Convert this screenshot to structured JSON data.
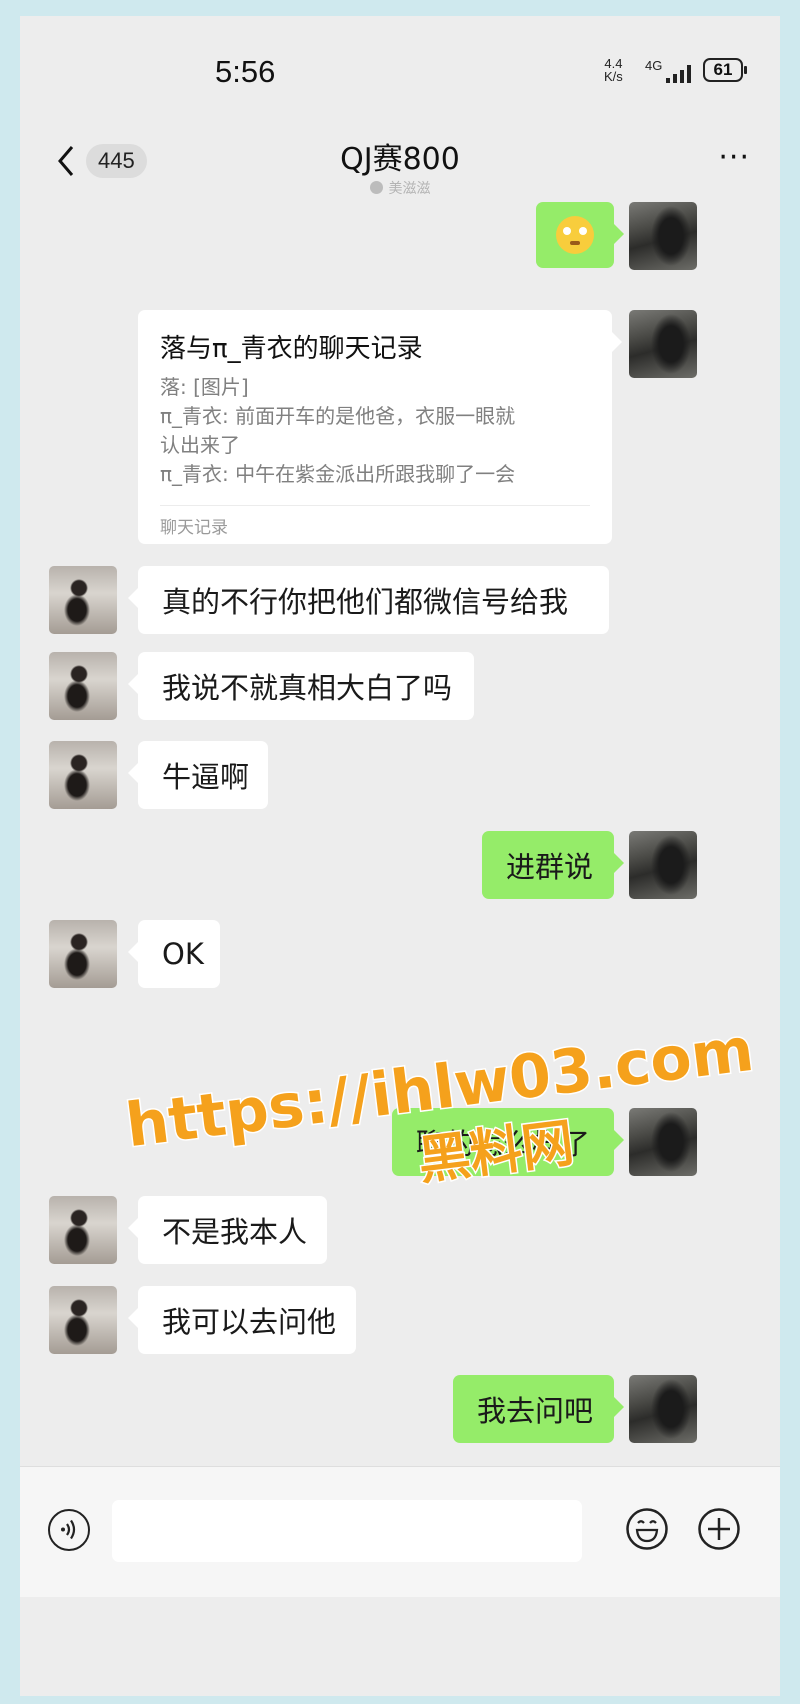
{
  "status_bar": {
    "time": "5:56",
    "net_speed_value": "4.4",
    "net_speed_unit": "K/s",
    "network_type": "4G",
    "battery": "61"
  },
  "header": {
    "back_count": "445",
    "title": "QJ赛800",
    "subtitle": "美滋滋",
    "more_label": "···"
  },
  "record_card": {
    "title": "落与π_青衣的聊天记录",
    "lines": [
      "落: [图片]",
      "π_青衣: 前面开车的是他爸，衣服一眼就",
      "认出来了",
      "π_青衣: 中午在紫金派出所跟我聊了一会"
    ],
    "footer": "聊天记录"
  },
  "messages": [
    {
      "side": "in",
      "text": "真的不行你把他们都微信号给我"
    },
    {
      "side": "in",
      "text": "我说不就真相大白了吗"
    },
    {
      "side": "in",
      "text": "牛逼啊"
    },
    {
      "side": "out",
      "text": "进群说"
    },
    {
      "side": "in",
      "text": "OK"
    },
    {
      "side": "out",
      "text": "聊的怎么样了"
    },
    {
      "side": "in",
      "text": "不是我本人"
    },
    {
      "side": "in",
      "text": "我可以去问他"
    },
    {
      "side": "out",
      "text": "我去问吧"
    }
  ],
  "watermark": {
    "line1": "https://ihlw03.com",
    "line2": "黑料网",
    "fill_color": "#f5a11c",
    "stroke_color": "#ffffff"
  },
  "input_bar": {
    "placeholder": ""
  },
  "icons": {
    "back": "chevron-left-icon",
    "voice": "voice-icon",
    "emoji": "smiley-icon",
    "plus": "plus-icon"
  },
  "colors": {
    "bubble_out": "#95ec69",
    "bubble_in": "#ffffff",
    "chat_background": "#ededed"
  }
}
